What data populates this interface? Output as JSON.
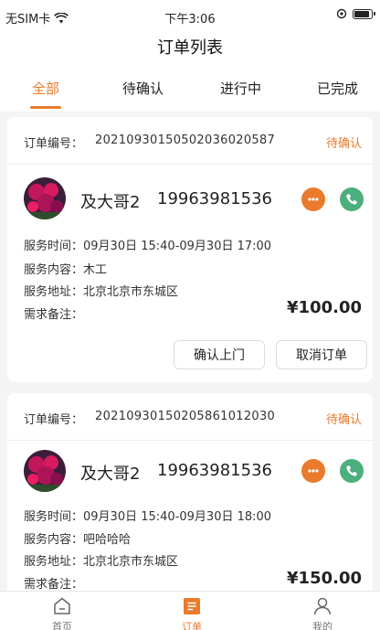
{
  "status_bar": {
    "carrier": "无SIM卡",
    "time": "下午3:06"
  },
  "nav": {
    "title": "订单列表"
  },
  "tabs": [
    {
      "label": "全部",
      "active": true
    },
    {
      "label": "待确认",
      "active": false
    },
    {
      "label": "进行中",
      "active": false
    },
    {
      "label": "已完成",
      "active": false
    }
  ],
  "labels": {
    "order_no": "订单编号：",
    "service_time": "服务时间：",
    "service_content": "服务内容：",
    "service_address": "服务地址：",
    "remark": "需求备注："
  },
  "orders": [
    {
      "order_no": "20210930150502036020587",
      "status": "待确认",
      "customer_name": "及大哥2",
      "phone": "19963981536",
      "service_time": "09月30日 15:40-09月30日 17:00",
      "service_content": "木工",
      "service_address": "北京北京市东城区",
      "remark": "",
      "price": "¥100.00",
      "actions": [
        "确认上门",
        "取消订单"
      ]
    },
    {
      "order_no": "20210930150205861012030",
      "status": "待确认",
      "customer_name": "及大哥2",
      "phone": "19963981536",
      "service_time": "09月30日 15:40-09月30日 18:00",
      "service_content": "吧哈哈哈",
      "service_address": "北京北京市东城区",
      "remark": "",
      "price": "¥150.00"
    }
  ],
  "tabbar": [
    {
      "label": "首页",
      "icon": "home-icon",
      "active": false
    },
    {
      "label": "订单",
      "icon": "order-icon",
      "active": true
    },
    {
      "label": "我的",
      "icon": "user-icon",
      "active": false
    }
  ],
  "colors": {
    "accent": "#ea7a2c",
    "call_green": "#4caf7d"
  }
}
